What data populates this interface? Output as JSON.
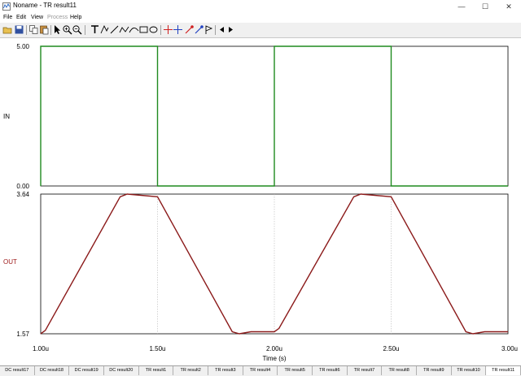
{
  "window": {
    "title": "Noname - TR result11",
    "minimize_label": "—",
    "maximize_label": "☐",
    "close_label": "✕"
  },
  "menu": [
    {
      "label": "File",
      "enabled": true
    },
    {
      "label": "Edit",
      "enabled": true
    },
    {
      "label": "View",
      "enabled": true
    },
    {
      "label": "Process",
      "enabled": false
    },
    {
      "label": "Help",
      "enabled": true
    }
  ],
  "toolbar": {
    "icons": [
      "open-icon",
      "save-icon",
      "copy-icon",
      "paste-icon",
      "select-arrow-icon",
      "zoom-in-icon",
      "zoom-out-icon",
      "text-icon",
      "cursor-tool-icon",
      "line-tool-icon",
      "polyline-tool-icon",
      "curve-tool-icon",
      "rectangle-tool-icon",
      "ellipse-tool-icon",
      "cursor-a-icon",
      "cursor-b-icon",
      "marker-a-icon",
      "marker-b-icon",
      "flag-icon",
      "left-arrow-icon",
      "right-arrow-icon"
    ]
  },
  "colors": {
    "in_trace": "#1f8a1f",
    "out_trace": "#8b1a1a",
    "out_label": "#a02020",
    "grid": "#b8b8b8",
    "axis": "#000000"
  },
  "chart_data": [
    {
      "type": "line",
      "series": [
        {
          "name": "IN",
          "x": [
            1.0,
            1.0,
            1.5,
            1.5,
            2.0,
            2.0,
            2.5,
            2.5,
            3.0
          ],
          "y": [
            0.0,
            5.0,
            5.0,
            0.0,
            0.0,
            5.0,
            5.0,
            0.0,
            0.0
          ]
        }
      ],
      "ylim": [
        0.0,
        5.0
      ],
      "ytick_labels": [
        "5.00",
        "0.00"
      ],
      "ylabel": "IN",
      "grid": true
    },
    {
      "type": "line",
      "series": [
        {
          "name": "OUT",
          "x": [
            1.0,
            1.02,
            1.34,
            1.37,
            1.5,
            1.82,
            1.85,
            1.9,
            2.0,
            2.02,
            2.34,
            2.37,
            2.5,
            2.82,
            2.85,
            2.9,
            3.0
          ],
          "y": [
            1.57,
            1.62,
            3.6,
            3.64,
            3.6,
            1.6,
            1.57,
            1.6,
            1.6,
            1.65,
            3.6,
            3.64,
            3.6,
            1.6,
            1.57,
            1.6,
            1.6
          ]
        }
      ],
      "ylim": [
        1.57,
        3.64
      ],
      "ytick_labels": [
        "3.64",
        "1.57"
      ],
      "ylabel": "OUT",
      "xlim": [
        1.0,
        3.0
      ],
      "xtick_labels": [
        "1.00u",
        "1.50u",
        "2.00u",
        "2.50u",
        "3.00u"
      ],
      "xticks": [
        1.0,
        1.5,
        2.0,
        2.5,
        3.0
      ],
      "xlabel": "Time (s)",
      "grid": true
    }
  ],
  "tabs": [
    {
      "label": "DC result17",
      "active": false
    },
    {
      "label": "DC result18",
      "active": false
    },
    {
      "label": "DC result19",
      "active": false
    },
    {
      "label": "DC result20",
      "active": false
    },
    {
      "label": "TR result1",
      "active": false
    },
    {
      "label": "TR result2",
      "active": false
    },
    {
      "label": "TR result3",
      "active": false
    },
    {
      "label": "TR result4",
      "active": false
    },
    {
      "label": "TR result5",
      "active": false
    },
    {
      "label": "TR result6",
      "active": false
    },
    {
      "label": "TR result7",
      "active": false
    },
    {
      "label": "TR result8",
      "active": false
    },
    {
      "label": "TR result9",
      "active": false
    },
    {
      "label": "TR result10",
      "active": false
    },
    {
      "label": "TR result11",
      "active": true
    }
  ]
}
